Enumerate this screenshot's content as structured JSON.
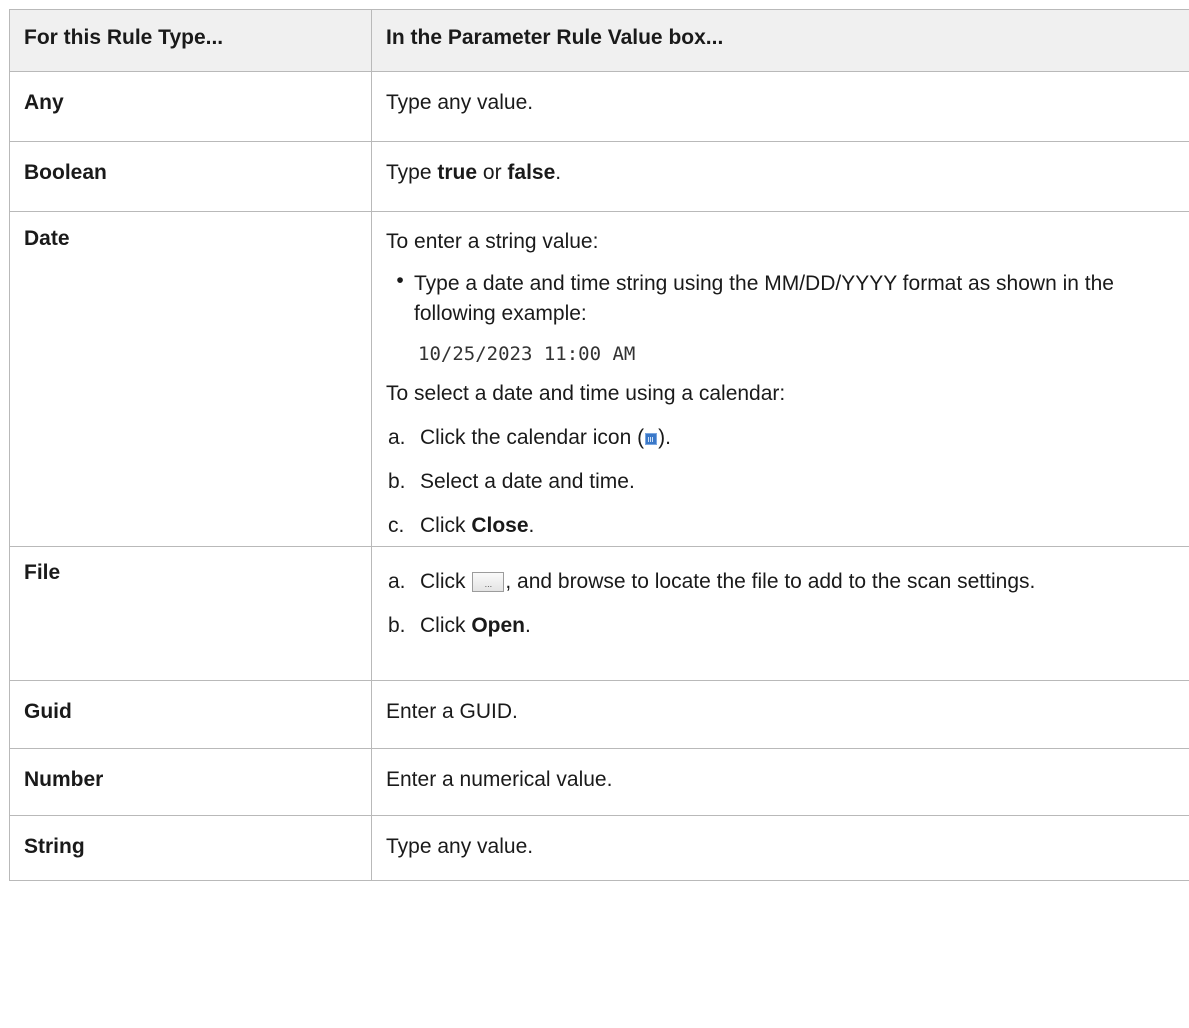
{
  "header": {
    "col1": "For this Rule Type...",
    "col2": "In the Parameter Rule Value box..."
  },
  "rows": {
    "any": {
      "type": "Any",
      "text": "Type any value."
    },
    "boolean": {
      "type": "Boolean",
      "pre": "Type ",
      "v1": "true",
      "mid": " or ",
      "v2": "false",
      "post": "."
    },
    "date": {
      "type": "Date",
      "intro1": "To enter a string value:",
      "bullet": "Type a date and time string using the MM/DD/YYYY format as shown in the following example:",
      "example": "10/25/2023 11:00 AM",
      "intro2": "To select a date and time using a calendar:",
      "step_a_label": "a.",
      "step_a_pre": "Click the calendar icon (",
      "step_a_post": ").",
      "step_b_label": "b.",
      "step_b": "Select a date and time.",
      "step_c_label": "c.",
      "step_c_pre": "Click ",
      "step_c_bold": "Close",
      "step_c_post": "."
    },
    "file": {
      "type": "File",
      "step_a_label": "a.",
      "step_a_pre": "Click ",
      "step_a_post": ", and browse to locate the file to add to the scan settings.",
      "browse_glyph": "...",
      "step_b_label": "b.",
      "step_b_pre": "Click ",
      "step_b_bold": "Open",
      "step_b_post": "."
    },
    "guid": {
      "type": "Guid",
      "text": "Enter a GUID."
    },
    "number": {
      "type": "Number",
      "text": "Enter a numerical value."
    },
    "string": {
      "type": "String",
      "text": "Type any value."
    }
  },
  "icons": {
    "calendar": "calendar-icon",
    "browse": "browse-button-icon"
  }
}
